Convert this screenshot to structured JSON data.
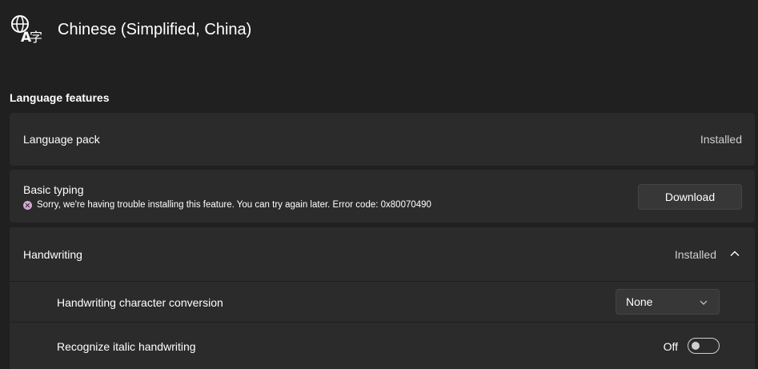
{
  "header": {
    "title": "Chinese (Simplified, China)",
    "icon": "language-icon"
  },
  "section": {
    "title": "Language features"
  },
  "language_pack": {
    "label": "Language pack",
    "status": "Installed"
  },
  "basic_typing": {
    "label": "Basic typing",
    "error": "Sorry, we're having trouble installing this feature. You can try again later. Error code: 0x80070490",
    "button": "Download",
    "error_icon": "error-icon",
    "error_color": "#d8a8d6"
  },
  "handwriting": {
    "label": "Handwriting",
    "status": "Installed",
    "char_conversion": {
      "label": "Handwriting character conversion",
      "value": "None"
    },
    "italic": {
      "label": "Recognize italic handwriting",
      "state": "Off"
    }
  },
  "colors": {
    "background": "#202020",
    "card": "#2b2b2b",
    "button": "#373737"
  }
}
